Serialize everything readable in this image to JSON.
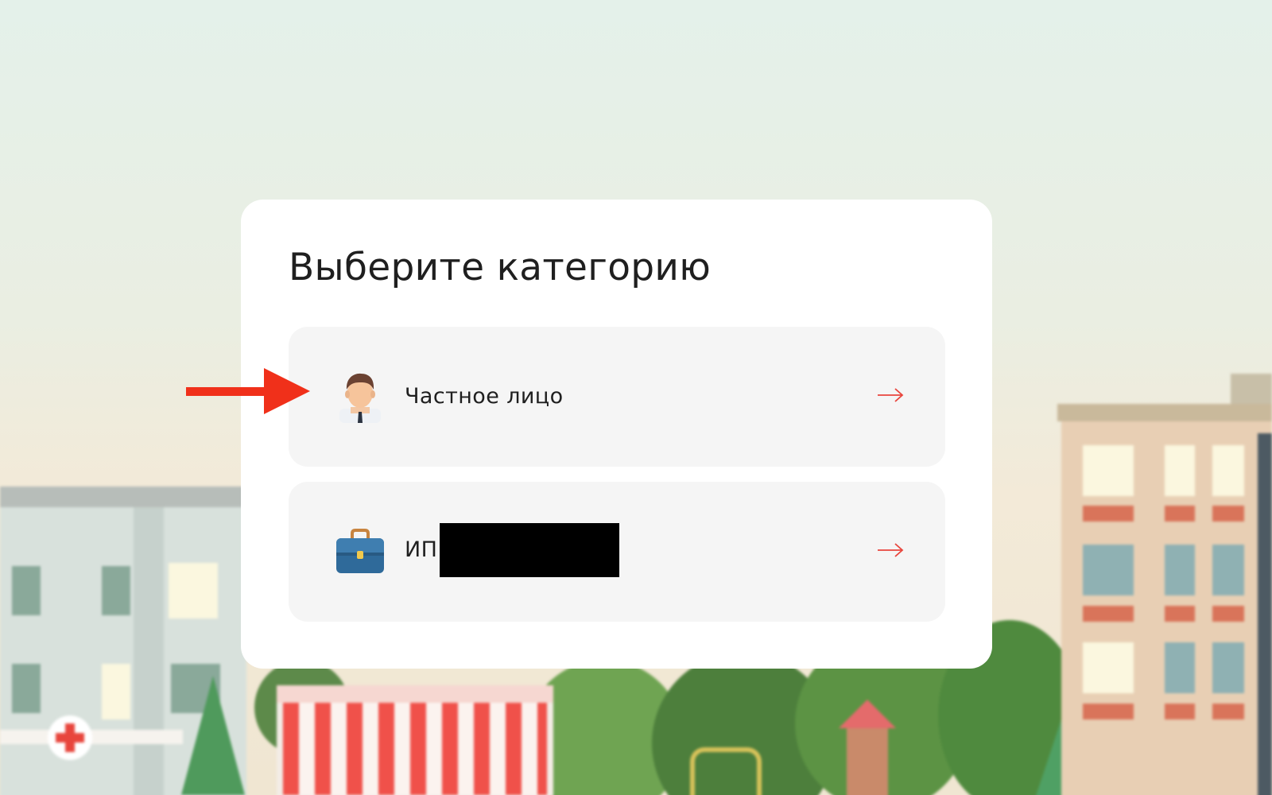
{
  "page": {
    "title": "Выберите категорию",
    "options": [
      {
        "label": "Частное лицо",
        "icon": "person-icon",
        "arrow_icon": "arrow-right-icon"
      },
      {
        "label": "ИП",
        "icon": "briefcase-icon",
        "arrow_icon": "arrow-right-icon"
      }
    ]
  },
  "colors": {
    "accent": "#e8453c",
    "annotation_arrow": "#f0301a",
    "card_bg": "#ffffff",
    "option_bg": "#f5f5f5",
    "title_text": "#1f1f1f"
  }
}
